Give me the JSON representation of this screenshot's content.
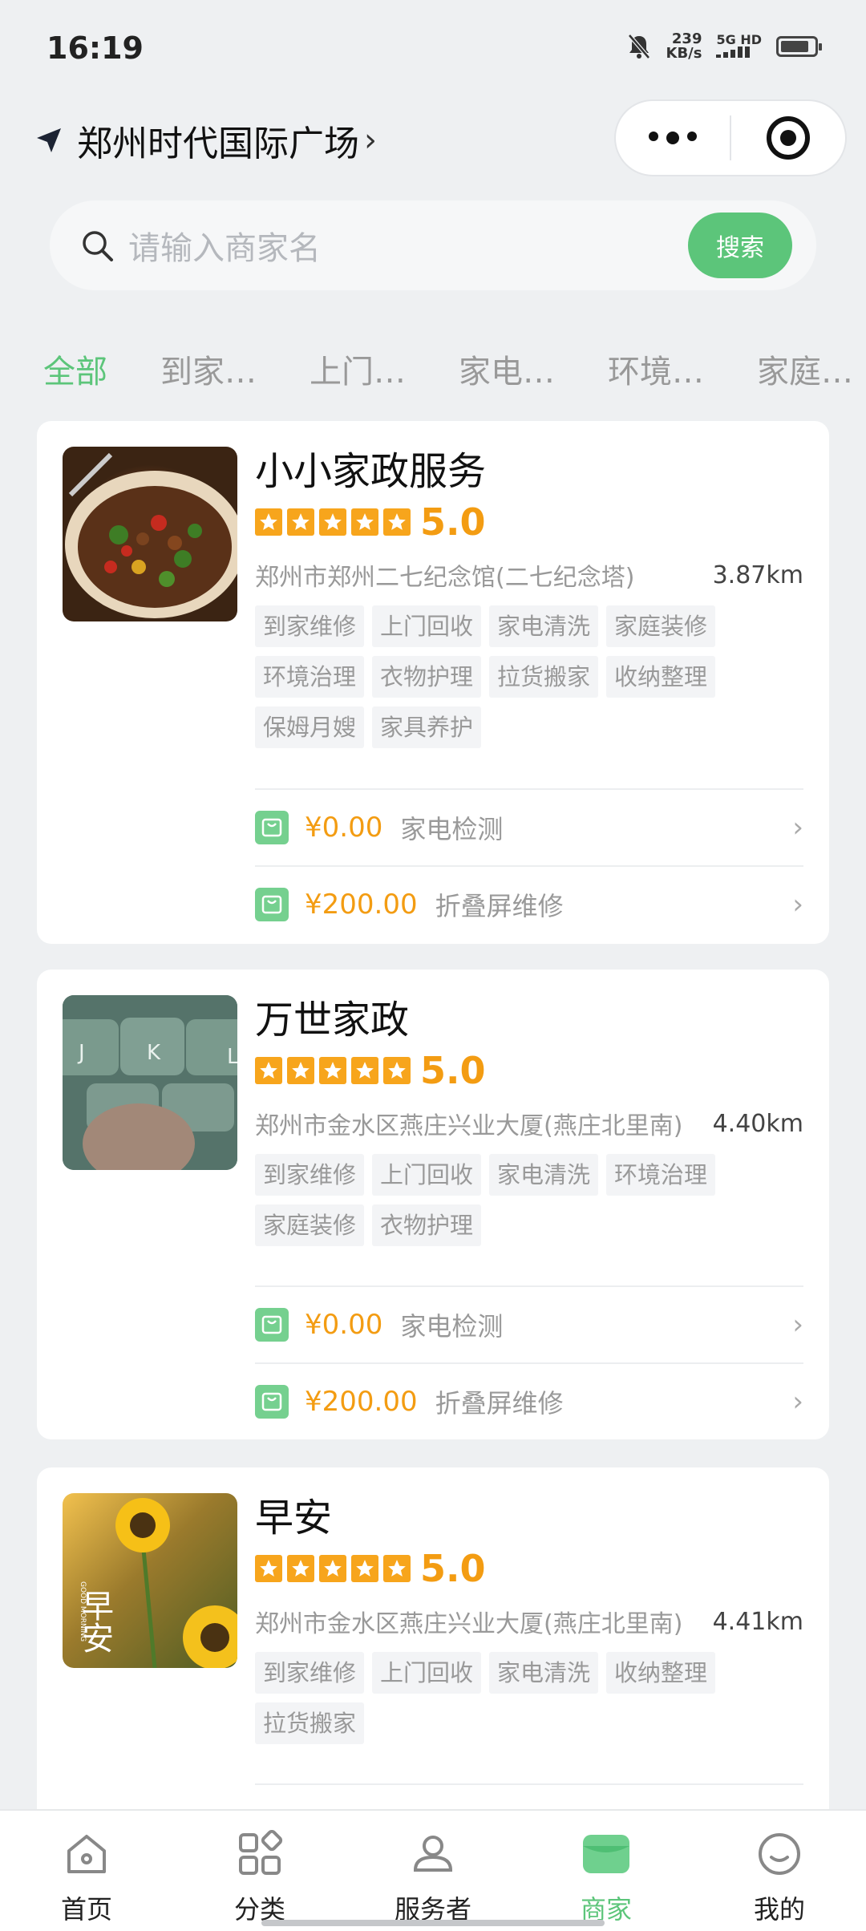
{
  "status": {
    "time": "16:19",
    "net_speed_value": "239",
    "net_speed_unit": "KB/s",
    "signal": "5G HD"
  },
  "header": {
    "location": "郑州时代国际广场"
  },
  "search": {
    "placeholder": "请输入商家名",
    "button": "搜索"
  },
  "tabs": [
    "全部",
    "到家…",
    "上门…",
    "家电…",
    "环境…",
    "家庭…"
  ],
  "merchants": [
    {
      "name": "小小家政服务",
      "rating": "5.0",
      "address": "郑州市郑州二七纪念馆(二七纪念塔)",
      "distance": "3.87km",
      "tags": [
        "到家维修",
        "上门回收",
        "家电清洗",
        "家庭装修",
        "环境治理",
        "衣物护理",
        "拉货搬家",
        "收纳整理",
        "保姆月嫂",
        "家具养护"
      ],
      "services": [
        {
          "price": "¥0.00",
          "name": "家电检测"
        },
        {
          "price": "¥200.00",
          "name": "折叠屏维修"
        }
      ]
    },
    {
      "name": "万世家政",
      "rating": "5.0",
      "address": "郑州市金水区燕庄兴业大厦(燕庄北里南)",
      "distance": "4.40km",
      "tags": [
        "到家维修",
        "上门回收",
        "家电清洗",
        "环境治理",
        "家庭装修",
        "衣物护理"
      ],
      "services": [
        {
          "price": "¥0.00",
          "name": "家电检测"
        },
        {
          "price": "¥200.00",
          "name": "折叠屏维修"
        }
      ]
    },
    {
      "name": "早安",
      "rating": "5.0",
      "address": "郑州市金水区燕庄兴业大厦(燕庄北里南)",
      "distance": "4.41km",
      "tags": [
        "到家维修",
        "上门回收",
        "家电清洗",
        "收纳整理",
        "拉货搬家"
      ],
      "services": []
    }
  ],
  "thumb_text": {
    "morning": "早安",
    "good_morning": "GOOD MORNING",
    "keys": [
      "J",
      "K",
      "L"
    ]
  },
  "tabbar": [
    "首页",
    "分类",
    "服务者",
    "商家",
    "我的"
  ],
  "colors": {
    "accent": "#5cc57a",
    "price": "#f39c12",
    "star": "#f7a51c"
  }
}
